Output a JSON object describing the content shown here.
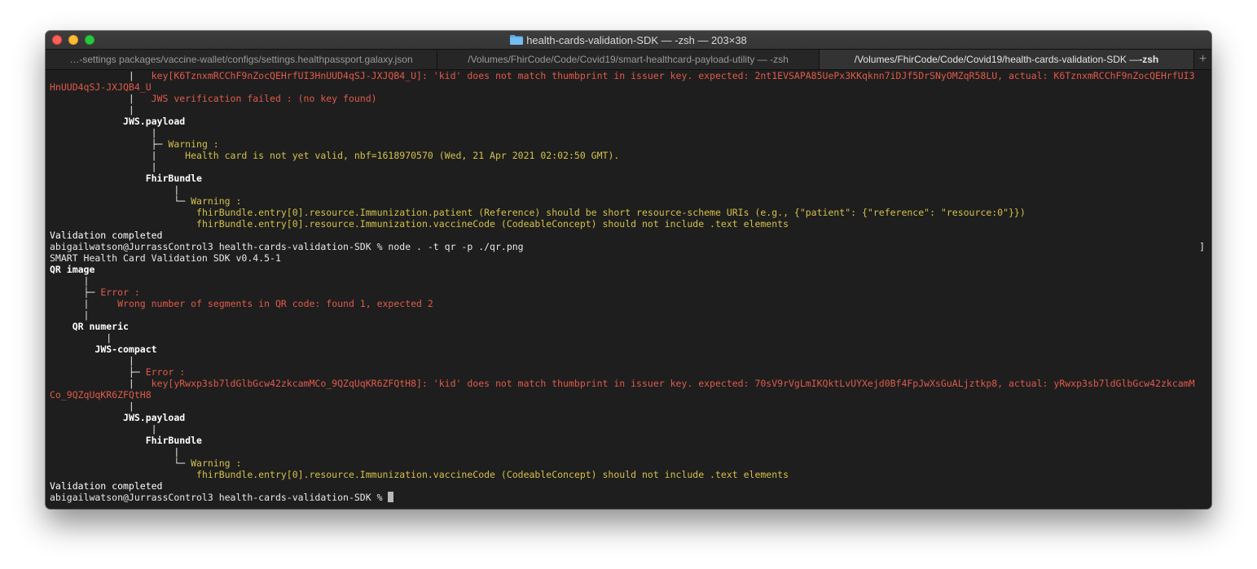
{
  "window": {
    "title": "health-cards-validation-SDK — -zsh — 203×38"
  },
  "tabs": [
    {
      "label": "…-settings packages/vaccine-wallet/configs/settings.healthpassport.galaxy.json"
    },
    {
      "label": "/Volumes/FhirCode/Code/Covid19/smart-healthcard-payload-utility — -zsh"
    },
    {
      "label_path": "/Volumes/FhirCode/Code/Covid19/health-cards-validation-SDK — ",
      "label_shell": "-zsh"
    }
  ],
  "add_tab_label": "+",
  "terminal": {
    "l1_pipe": "              |   ",
    "l1_text": "key[K6TznxmRCChF9nZocQEHrfUI3HnUUD4qSJ-JXJQB4_U]: 'kid' does not match thumbprint in issuer key. expected: 2nt1EVSAPA85UePx3KKqknn7iDJf5DrSNyOMZqR58LU, actual: K6TznxmRCChF9nZocQEHrfUI3",
    "l2_text": "HnUUD4qSJ-JXJQB4_U",
    "l3_pipe": "              |   ",
    "l3_text": "JWS verification failed : (no key found)",
    "l4_pipe": "              |",
    "l5_indent": "             ",
    "l5_text": "JWS.payload",
    "l6": "                  |",
    "l7_tree": "                  ├─ ",
    "l7_text": "Warning :",
    "l8_pipe": "                  |     ",
    "l8_text": "Health card is not yet valid, nbf=1618970570 (Wed, 21 Apr 2021 02:02:50 GMT).",
    "l9": "                  |",
    "l10_indent": "                 ",
    "l10_text": "FhirBundle",
    "l11": "                      |",
    "l12_tree": "                      └─ ",
    "l12_text": "Warning :",
    "l13_indent": "                          ",
    "l13_text": "fhirBundle.entry[0].resource.Immunization.patient (Reference) should be short resource-scheme URIs (e.g., {\"patient\": {\"reference\": \"resource:0\"}})",
    "l14_indent": "                          ",
    "l14_text": "fhirBundle.entry[0].resource.Immunization.vaccineCode (CodeableConcept) should not include .text elements",
    "l15": "Validation completed",
    "l16_prompt": "abigailwatson@JurrassControl3 health-cards-validation-SDK % ",
    "l16_cmd": "node . -t qr -p ./qr.png",
    "l17": "SMART Health Card Validation SDK v0.4.5-1",
    "l18": "QR image",
    "l19": "      |",
    "l20_tree": "      ├─ ",
    "l20_text": "Error :",
    "l21_pipe": "      |     ",
    "l21_text": "Wrong number of segments in QR code: found 1, expected 2",
    "l22": "      |",
    "l23_indent": "    ",
    "l23_text": "QR numeric",
    "l24": "          |",
    "l25_indent": "        ",
    "l25_text": "JWS-compact",
    "l26": "              |",
    "l27_tree": "              ├─ ",
    "l27_text": "Error :",
    "l28_pipe": "              |   ",
    "l28_text": "key[yRwxp3sb7ldGlbGcw42zkcamMCo_9QZqUqKR6ZFQtH8]: 'kid' does not match thumbprint in issuer key. expected: 70sV9rVgLmIKQktLvUYXejd0Bf4FpJwXsGuALjztkp8, actual: yRwxp3sb7ldGlbGcw42zkcamM",
    "l29_text": "Co_9QZqUqKR6ZFQtH8",
    "l30": "              |",
    "l31_indent": "             ",
    "l31_text": "JWS.payload",
    "l32": "                  |",
    "l33_indent": "                 ",
    "l33_text": "FhirBundle",
    "l34": "                      |",
    "l35_tree": "                      └─ ",
    "l35_text": "Warning :",
    "l36_indent": "                          ",
    "l36_text": "fhirBundle.entry[0].resource.Immunization.vaccineCode (CodeableConcept) should not include .text elements",
    "l37": "Validation completed",
    "l38_prompt": "abigailwatson@JurrassControl3 health-cards-validation-SDK % "
  },
  "colors": {
    "error": "#e05a4a",
    "warning": "#d3c04a",
    "background": "#1e1e1e",
    "text": "#e8e8e8"
  }
}
